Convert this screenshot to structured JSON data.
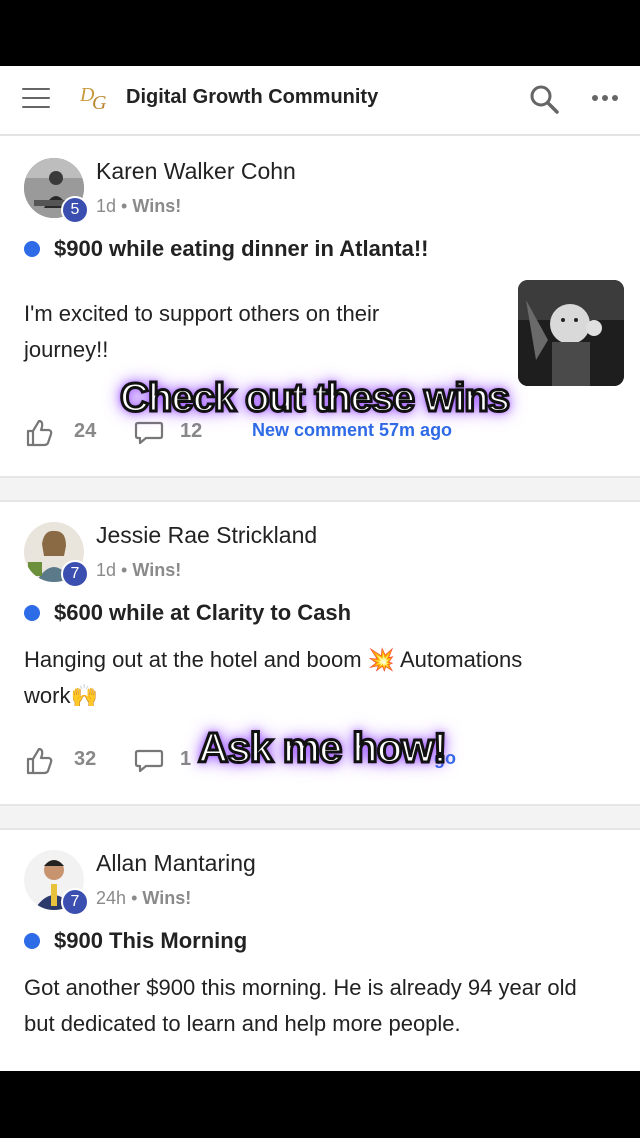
{
  "header": {
    "title": "Digital Growth Community",
    "logo_text_d": "D",
    "logo_text_g": "G",
    "icons": {
      "menu": "hamburger-icon",
      "search": "search-icon",
      "more": "more-icon"
    }
  },
  "posts": [
    {
      "author": "Karen Walker Cohn",
      "level": "5",
      "time": "1d",
      "category": "Wins!",
      "title": "$900 while eating dinner in Atlanta!!",
      "body_lines": [
        "I'm excited to support others on their",
        "journey!!"
      ],
      "likes": "24",
      "comments": "12",
      "new_comment": "New comment 57m ago"
    },
    {
      "author": "Jessie Rae Strickland",
      "level": "7",
      "time": "1d",
      "category": "Wins!",
      "title": "$600 while at Clarity to Cash",
      "body_lines": [
        "Hanging out at the hotel and boom 💥 Automations",
        "work🙌"
      ],
      "likes": "32",
      "comments": "1",
      "new_comment": "go"
    },
    {
      "author": "Allan Mantaring",
      "level": "7",
      "time": "24h",
      "category": "Wins!",
      "title": "$900 This Morning",
      "body_lines": [
        "Got another $900 this morning. He is already 94 year old",
        "but dedicated to learn and help more people."
      ]
    }
  ],
  "overlay_captions": [
    "Check out these wins",
    "Ask me how!"
  ],
  "meta_separator": "•",
  "colors": {
    "accent_blue": "#2e6be6",
    "badge": "#3b4fb0",
    "caption_glow": "#9b4dff"
  }
}
